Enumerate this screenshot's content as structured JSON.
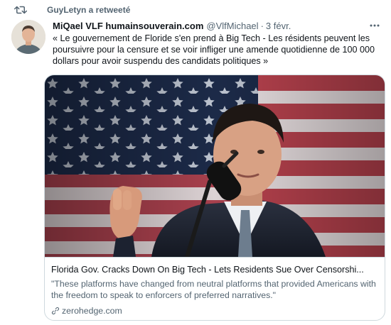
{
  "retweet": {
    "label": "GuyLetyn a retweeté"
  },
  "tweet": {
    "author_name": "MiQael VLF humainsouverain.com",
    "handle": "@VlfMichael",
    "separator": "·",
    "date": "3 févr.",
    "text": "« Le gouvernement de Floride s'en prend à Big Tech - Les résidents peuvent les poursuivre pour la censure et se voir infliger une amende quotidienne de 100 000 dollars pour avoir suspendu des candidats politiques »"
  },
  "card": {
    "title": "Florida Gov. Cracks Down On Big Tech - Lets Residents Sue Over Censorshi...",
    "description": "\"These platforms have changed from neutral platforms that provided Americans with the freedom to speak to enforcers of preferred narratives.\"",
    "domain": "zerohedge.com"
  },
  "icons": {
    "retweet": "retweet-icon",
    "more": "more-icon",
    "link": "link-icon"
  },
  "colors": {
    "text_primary": "#0f1419",
    "text_secondary": "#536471",
    "border": "#cfd9de"
  }
}
